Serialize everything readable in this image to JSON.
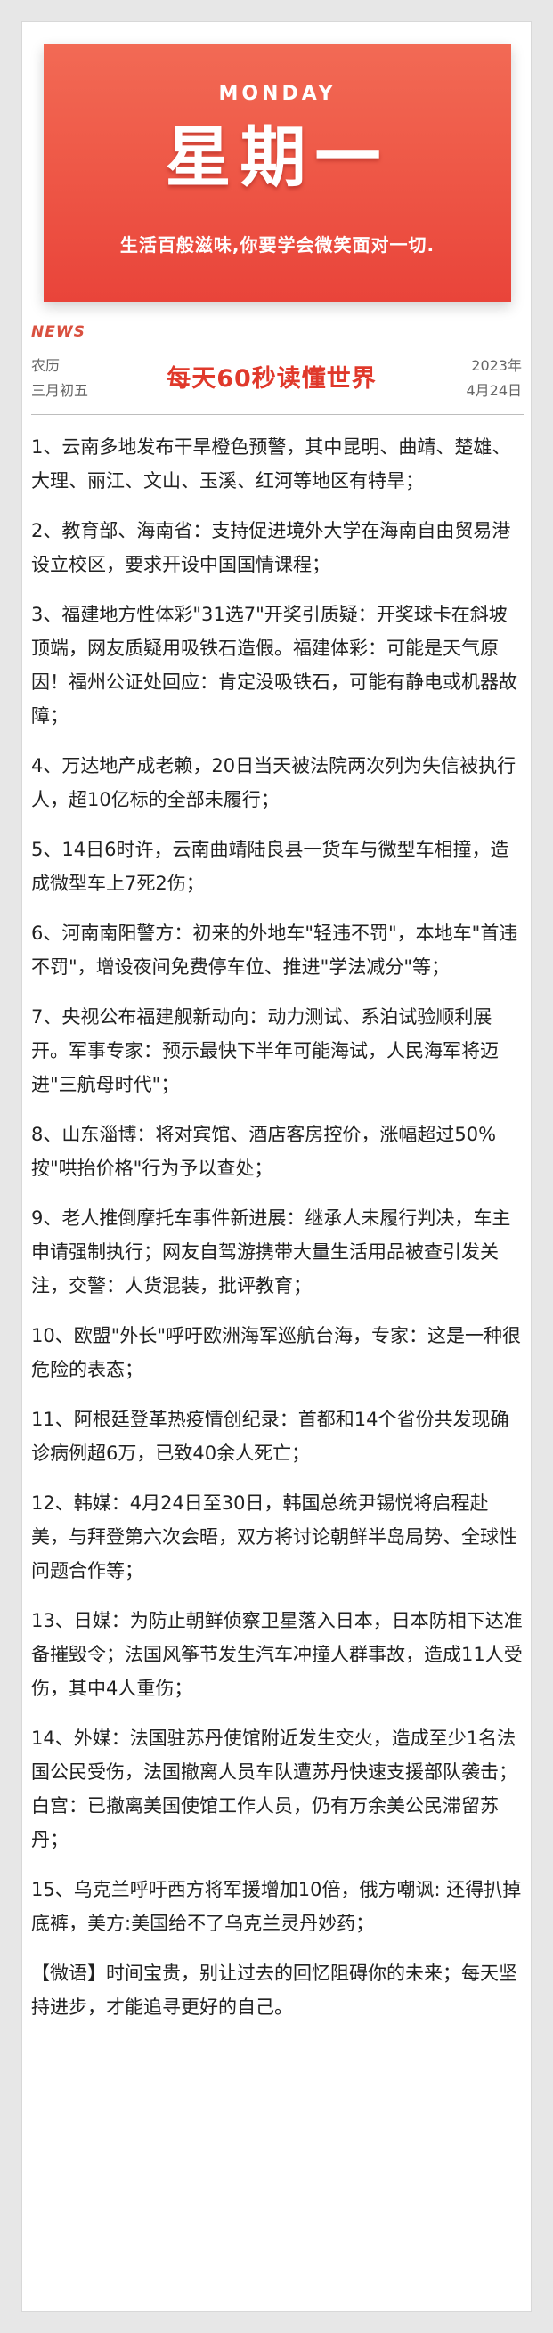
{
  "banner": {
    "weekday_en": "MONDAY",
    "weekday_cn": "星期一",
    "slogan": "生活百般滋味,你要学会微笑面对一切."
  },
  "header": {
    "news_label": "NEWS",
    "lunar_line1": "农历",
    "lunar_line2": "三月初五",
    "headline": "每天60秒读懂世界",
    "date_line1": "2023年",
    "date_line2": "4月24日"
  },
  "news": [
    "1、云南多地发布干旱橙色预警，其中昆明、曲靖、楚雄、大理、丽江、文山、玉溪、红河等地区有特旱；",
    "2、教育部、海南省：支持促进境外大学在海南自由贸易港设立校区，要求开设中国国情课程；",
    "3、福建地方性体彩\"31选7\"开奖引质疑：开奖球卡在斜坡顶端，网友质疑用吸铁石造假。福建体彩：可能是天气原因！福州公证处回应：肯定没吸铁石，可能有静电或机器故障；",
    "4、万达地产成老赖，20日当天被法院两次列为失信被执行人，超10亿标的全部未履行；",
    "5、14日6时许，云南曲靖陆良县一货车与微型车相撞，造成微型车上7死2伤；",
    "6、河南南阳警方：初来的外地车\"轻违不罚\"，本地车\"首违不罚\"，增设夜间免费停车位、推进\"学法减分\"等；",
    "7、央视公布福建舰新动向：动力测试、系泊试验顺利展开。军事专家：预示最快下半年可能海试，人民海军将迈进\"三航母时代\"；",
    "8、山东淄博：将对宾馆、酒店客房控价，涨幅超过50%按\"哄抬价格\"行为予以查处；",
    "9、老人推倒摩托车事件新进展：继承人未履行判决，车主申请强制执行；网友自驾游携带大量生活用品被查引发关注，交警：人货混装，批评教育；",
    "10、欧盟\"外长\"呼吁欧洲海军巡航台海，专家：这是一种很危险的表态；",
    "11、阿根廷登革热疫情创纪录：首都和14个省份共发现确诊病例超6万，已致40余人死亡；",
    "12、韩媒：4月24日至30日，韩国总统尹锡悦将启程赴美，与拜登第六次会晤，双方将讨论朝鲜半岛局势、全球性问题合作等；",
    "13、日媒：为防止朝鲜侦察卫星落入日本，日本防相下达准备摧毁令；法国风筝节发生汽车冲撞人群事故，造成11人受伤，其中4人重伤；",
    "14、外媒：法国驻苏丹使馆附近发生交火，造成至少1名法国公民受伤，法国撤离人员车队遭苏丹快速支援部队袭击；白宫：已撤离美国使馆工作人员，仍有万余美公民滞留苏丹；",
    "15、乌克兰呼吁西方将军援增加10倍，俄方嘲讽: 还得扒掉底裤，美方:美国给不了乌克兰灵丹妙药；"
  ],
  "closing": "【微语】时间宝贵，别让过去的回忆阻碍你的未来；每天坚持进步，才能追寻更好的自己。"
}
